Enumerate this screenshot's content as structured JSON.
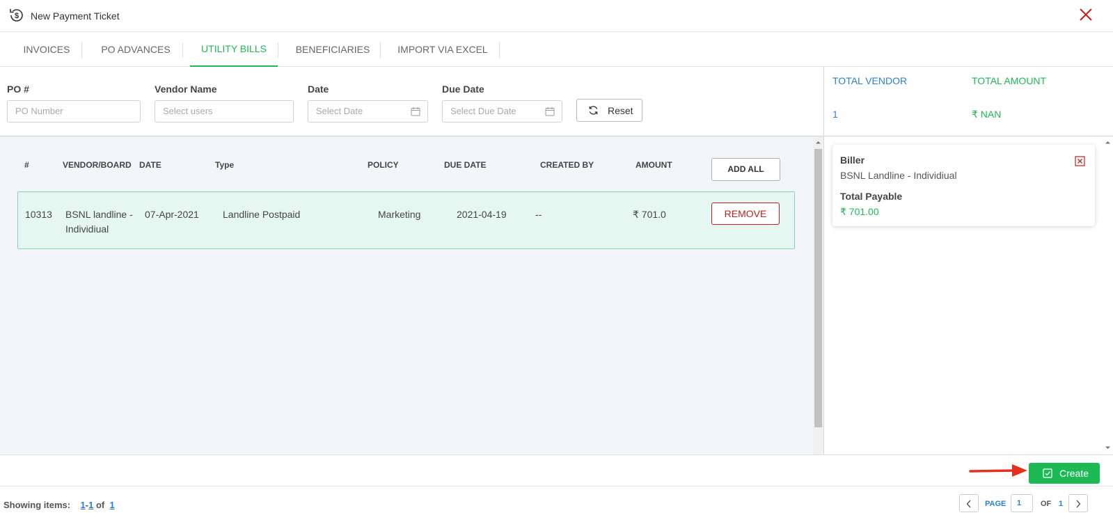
{
  "header": {
    "title": "New Payment Ticket",
    "logo_icon": "dollar-refresh-icon",
    "close_icon": "close-icon",
    "close_color": "#c0201b"
  },
  "tabs": [
    {
      "label": "INVOICES",
      "active": false
    },
    {
      "label": "PO ADVANCES",
      "active": false
    },
    {
      "label": "UTILITY BILLS",
      "active": true
    },
    {
      "label": "BENEFICIARIES",
      "active": false
    },
    {
      "label": "IMPORT VIA EXCEL",
      "active": false
    }
  ],
  "filters": {
    "po": {
      "label": "PO #",
      "placeholder": "PO Number"
    },
    "vendor": {
      "label": "Vendor Name",
      "placeholder": "Select users"
    },
    "date": {
      "label": "Date",
      "placeholder": "Select Date"
    },
    "due_date": {
      "label": "Due Date",
      "placeholder": "Select Due Date"
    },
    "reset_label": "Reset"
  },
  "totals": {
    "vendor_label": "TOTAL VENDOR",
    "vendor_value": "1",
    "amount_label": "TOTAL AMOUNT",
    "amount_value": "₹ NAN"
  },
  "table": {
    "columns": [
      "#",
      "VENDOR/BOARD",
      "DATE",
      "Type",
      "POLICY",
      "DUE DATE",
      "CREATED BY",
      "AMOUNT"
    ],
    "add_all_label": "ADD ALL",
    "rows": [
      {
        "id": "10313",
        "vendor_line1": "BSNL landline -",
        "vendor_line2": "Individiual",
        "date": "07-Apr-2021",
        "type": "Landline Postpaid",
        "policy": "Marketing",
        "due_date": "2021-04-19",
        "created_by": "--",
        "amount": "₹ 701.0",
        "action_label": "REMOVE"
      }
    ]
  },
  "biller_card": {
    "biller_label": "Biller",
    "biller_value": "BSNL Landline - Individiual",
    "total_label": "Total Payable",
    "total_value": "₹ 701.00"
  },
  "actions": {
    "create_label": "Create",
    "accent_color": "#1db954"
  },
  "footer": {
    "showing_label": "Showing items:",
    "range_start": "1",
    "range_end": "1",
    "of_label": "of",
    "total": "1",
    "page_label": "PAGE",
    "page_value": "1",
    "of_pages_label": "OF",
    "total_pages": "1"
  },
  "colors": {
    "accent_green": "#1db954",
    "link_blue": "#2a7fd4",
    "danger_red": "#c0201b",
    "row_highlight": "#e6f7f1"
  }
}
